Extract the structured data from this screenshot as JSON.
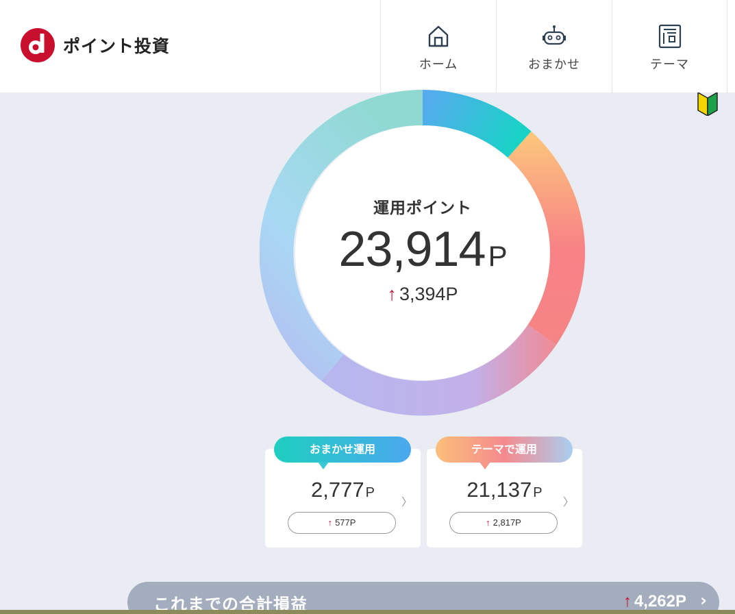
{
  "header": {
    "logo_text": "ポイント投資",
    "nav": [
      {
        "label": "ホーム",
        "icon": "home-icon"
      },
      {
        "label": "おまかせ",
        "icon": "robot-icon"
      },
      {
        "label": "テーマ",
        "icon": "theme-icon"
      }
    ]
  },
  "summary": {
    "label": "運用ポイント",
    "value": "23,914",
    "unit": "P",
    "change": "3,394P",
    "change_arrow": "↑"
  },
  "cards": {
    "omakase": {
      "tag": "おまかせ運用",
      "value": "2,777",
      "unit": "P",
      "change": "577P",
      "change_arrow": "↑"
    },
    "theme": {
      "tag": "テーマで運用",
      "value": "21,137",
      "unit": "P",
      "change": "2,817P",
      "change_arrow": "↑"
    }
  },
  "total": {
    "label": "これまでの合計損益",
    "value": "4,262P",
    "arrow": "↑"
  },
  "colors": {
    "brand_red": "#c8102e",
    "background": "#e9edf3",
    "total_bar": "#a3adbd"
  }
}
